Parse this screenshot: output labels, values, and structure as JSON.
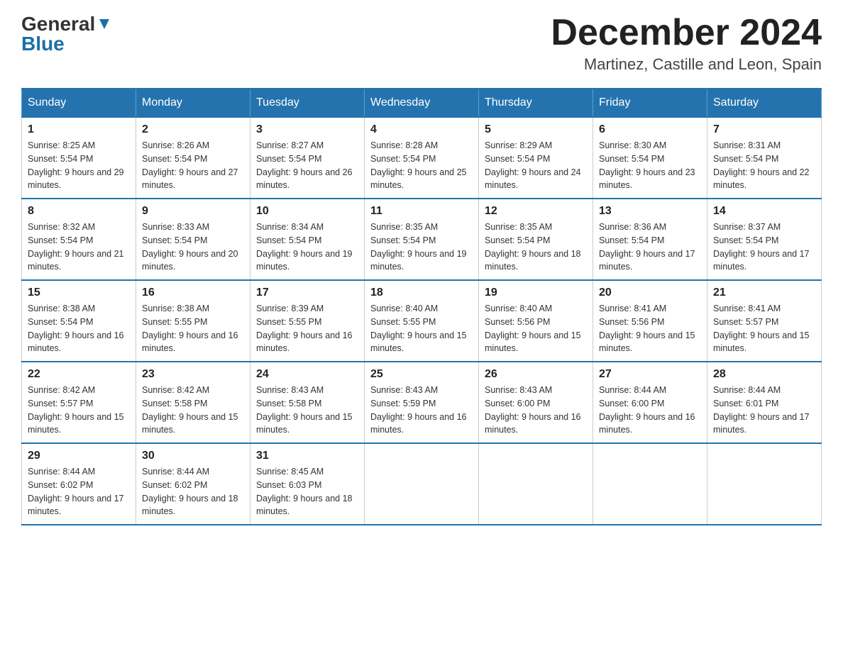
{
  "header": {
    "logo_general": "General",
    "logo_blue": "Blue",
    "month_title": "December 2024",
    "location": "Martinez, Castille and Leon, Spain"
  },
  "weekdays": [
    "Sunday",
    "Monday",
    "Tuesday",
    "Wednesday",
    "Thursday",
    "Friday",
    "Saturday"
  ],
  "weeks": [
    [
      {
        "day": "1",
        "sunrise": "8:25 AM",
        "sunset": "5:54 PM",
        "daylight": "9 hours and 29 minutes."
      },
      {
        "day": "2",
        "sunrise": "8:26 AM",
        "sunset": "5:54 PM",
        "daylight": "9 hours and 27 minutes."
      },
      {
        "day": "3",
        "sunrise": "8:27 AM",
        "sunset": "5:54 PM",
        "daylight": "9 hours and 26 minutes."
      },
      {
        "day": "4",
        "sunrise": "8:28 AM",
        "sunset": "5:54 PM",
        "daylight": "9 hours and 25 minutes."
      },
      {
        "day": "5",
        "sunrise": "8:29 AM",
        "sunset": "5:54 PM",
        "daylight": "9 hours and 24 minutes."
      },
      {
        "day": "6",
        "sunrise": "8:30 AM",
        "sunset": "5:54 PM",
        "daylight": "9 hours and 23 minutes."
      },
      {
        "day": "7",
        "sunrise": "8:31 AM",
        "sunset": "5:54 PM",
        "daylight": "9 hours and 22 minutes."
      }
    ],
    [
      {
        "day": "8",
        "sunrise": "8:32 AM",
        "sunset": "5:54 PM",
        "daylight": "9 hours and 21 minutes."
      },
      {
        "day": "9",
        "sunrise": "8:33 AM",
        "sunset": "5:54 PM",
        "daylight": "9 hours and 20 minutes."
      },
      {
        "day": "10",
        "sunrise": "8:34 AM",
        "sunset": "5:54 PM",
        "daylight": "9 hours and 19 minutes."
      },
      {
        "day": "11",
        "sunrise": "8:35 AM",
        "sunset": "5:54 PM",
        "daylight": "9 hours and 19 minutes."
      },
      {
        "day": "12",
        "sunrise": "8:35 AM",
        "sunset": "5:54 PM",
        "daylight": "9 hours and 18 minutes."
      },
      {
        "day": "13",
        "sunrise": "8:36 AM",
        "sunset": "5:54 PM",
        "daylight": "9 hours and 17 minutes."
      },
      {
        "day": "14",
        "sunrise": "8:37 AM",
        "sunset": "5:54 PM",
        "daylight": "9 hours and 17 minutes."
      }
    ],
    [
      {
        "day": "15",
        "sunrise": "8:38 AM",
        "sunset": "5:54 PM",
        "daylight": "9 hours and 16 minutes."
      },
      {
        "day": "16",
        "sunrise": "8:38 AM",
        "sunset": "5:55 PM",
        "daylight": "9 hours and 16 minutes."
      },
      {
        "day": "17",
        "sunrise": "8:39 AM",
        "sunset": "5:55 PM",
        "daylight": "9 hours and 16 minutes."
      },
      {
        "day": "18",
        "sunrise": "8:40 AM",
        "sunset": "5:55 PM",
        "daylight": "9 hours and 15 minutes."
      },
      {
        "day": "19",
        "sunrise": "8:40 AM",
        "sunset": "5:56 PM",
        "daylight": "9 hours and 15 minutes."
      },
      {
        "day": "20",
        "sunrise": "8:41 AM",
        "sunset": "5:56 PM",
        "daylight": "9 hours and 15 minutes."
      },
      {
        "day": "21",
        "sunrise": "8:41 AM",
        "sunset": "5:57 PM",
        "daylight": "9 hours and 15 minutes."
      }
    ],
    [
      {
        "day": "22",
        "sunrise": "8:42 AM",
        "sunset": "5:57 PM",
        "daylight": "9 hours and 15 minutes."
      },
      {
        "day": "23",
        "sunrise": "8:42 AM",
        "sunset": "5:58 PM",
        "daylight": "9 hours and 15 minutes."
      },
      {
        "day": "24",
        "sunrise": "8:43 AM",
        "sunset": "5:58 PM",
        "daylight": "9 hours and 15 minutes."
      },
      {
        "day": "25",
        "sunrise": "8:43 AM",
        "sunset": "5:59 PM",
        "daylight": "9 hours and 16 minutes."
      },
      {
        "day": "26",
        "sunrise": "8:43 AM",
        "sunset": "6:00 PM",
        "daylight": "9 hours and 16 minutes."
      },
      {
        "day": "27",
        "sunrise": "8:44 AM",
        "sunset": "6:00 PM",
        "daylight": "9 hours and 16 minutes."
      },
      {
        "day": "28",
        "sunrise": "8:44 AM",
        "sunset": "6:01 PM",
        "daylight": "9 hours and 17 minutes."
      }
    ],
    [
      {
        "day": "29",
        "sunrise": "8:44 AM",
        "sunset": "6:02 PM",
        "daylight": "9 hours and 17 minutes."
      },
      {
        "day": "30",
        "sunrise": "8:44 AM",
        "sunset": "6:02 PM",
        "daylight": "9 hours and 18 minutes."
      },
      {
        "day": "31",
        "sunrise": "8:45 AM",
        "sunset": "6:03 PM",
        "daylight": "9 hours and 18 minutes."
      },
      null,
      null,
      null,
      null
    ]
  ]
}
